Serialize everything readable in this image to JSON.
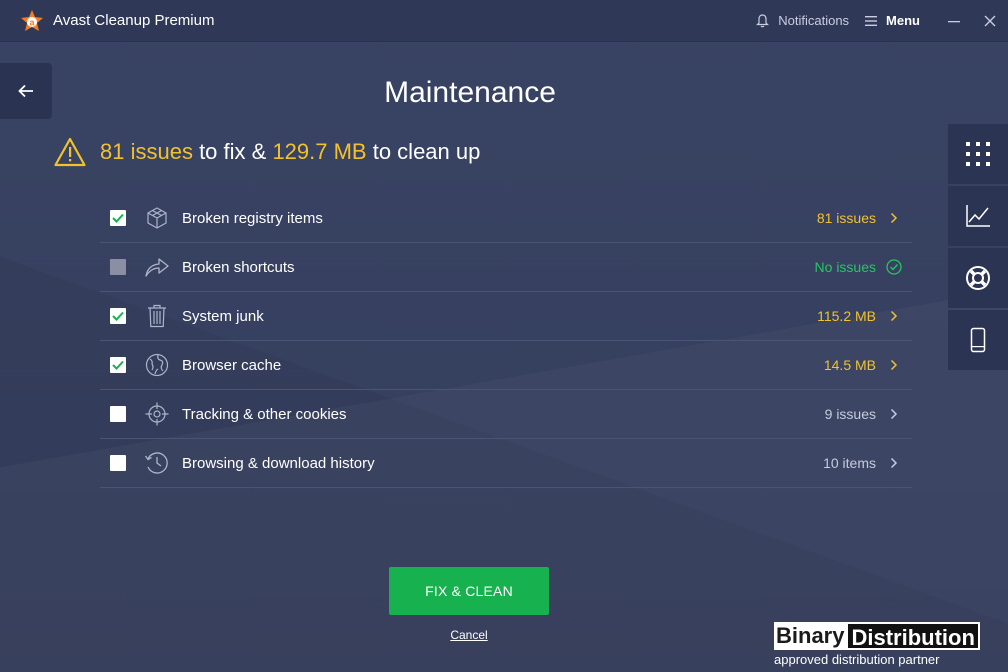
{
  "window": {
    "title": "Avast Cleanup Premium",
    "notifications_label": "Notifications",
    "menu_label": "Menu"
  },
  "page": {
    "title": "Maintenance"
  },
  "summary": {
    "issues": "81 issues",
    "text_to_fix": " to fix & ",
    "size": "129.7 MB",
    "text_cleanup": " to clean up"
  },
  "items": [
    {
      "label": "Broken registry items",
      "value": "81 issues",
      "checked": true,
      "icon": "cube-icon"
    },
    {
      "label": "Broken shortcuts",
      "value": "No issues",
      "checked": false,
      "disabled": true,
      "icon": "shortcut-arrow-icon"
    },
    {
      "label": "System junk",
      "value": "115.2 MB",
      "checked": true,
      "icon": "trash-icon"
    },
    {
      "label": "Browser cache",
      "value": "14.5 MB",
      "checked": true,
      "icon": "globe-icon"
    },
    {
      "label": "Tracking & other cookies",
      "value": "9 issues",
      "checked": false,
      "icon": "crosshair-icon"
    },
    {
      "label": "Browsing & download history",
      "value": "10 items",
      "checked": false,
      "icon": "history-clock-icon"
    }
  ],
  "actions": {
    "primary": "FIX & CLEAN",
    "cancel": "Cancel"
  },
  "watermark": {
    "part1": "Binary",
    "part2": "Distribution",
    "tagline": "approved distribution partner"
  },
  "colors": {
    "background": "#364061",
    "titlebar": "#2f3857",
    "accent_yellow": "#f2c12e",
    "success_green": "#27c564",
    "button_green": "#17b14f"
  }
}
